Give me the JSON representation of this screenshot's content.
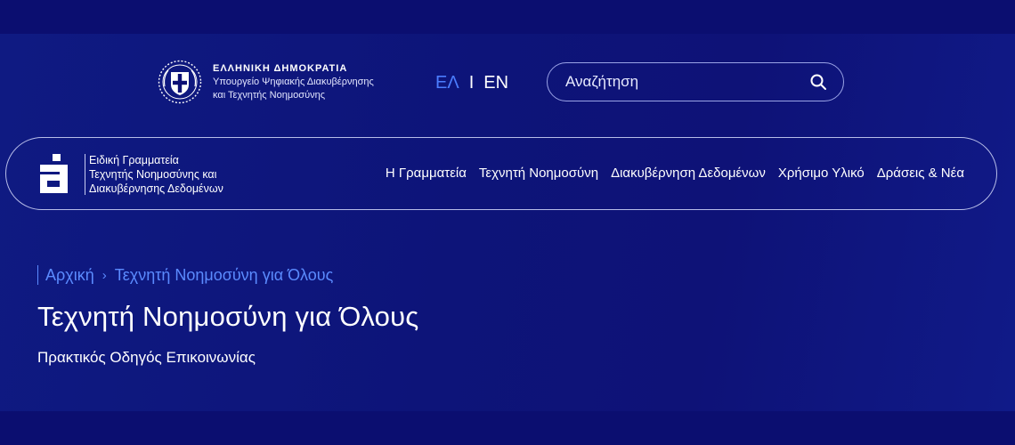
{
  "gov": {
    "title": "ΕΛΛΗΝΙΚΗ ΔΗΜΟΚΡΑΤΙΑ",
    "subtitle_line1": "Υπουργείο Ψηφιακής Διακυβέρνησης",
    "subtitle_line2": "και Τεχνητής Νοημοσύνης",
    "emblem_icon": "greek-coat-of-arms-icon"
  },
  "language": {
    "el": "ΕΛ",
    "separator": "I",
    "en": "EN",
    "active": "el"
  },
  "search": {
    "placeholder": "Αναζήτηση",
    "value": "",
    "icon": "search-icon"
  },
  "brand": {
    "logo_icon": "ai-logo-icon",
    "line1": "Ειδική Γραμματεία",
    "line2": "Τεχνητής Νοημοσύνης και",
    "line3": "Διακυβέρνησης Δεδομένων"
  },
  "nav": {
    "items": [
      {
        "label": "Η Γραμματεία"
      },
      {
        "label": "Τεχνητή Νοημοσύνη"
      },
      {
        "label": "Διακυβέρνηση Δεδομένων"
      },
      {
        "label": "Χρήσιμο Υλικό"
      },
      {
        "label": "Δράσεις & Νέα"
      }
    ]
  },
  "breadcrumb": {
    "home": "Αρχική",
    "separator": "›",
    "current": "Τεχνητή Νοημοσύνη για Όλους"
  },
  "page": {
    "title": "Τεχνητή Νοημοσύνη για Όλους",
    "subtitle": "Πρακτικός Οδηγός Επικοινωνίας"
  },
  "colors": {
    "background": "#0c0f74",
    "accent": "#4b7dff",
    "breadcrumb": "#5b8bff",
    "border": "#b7bde8"
  }
}
